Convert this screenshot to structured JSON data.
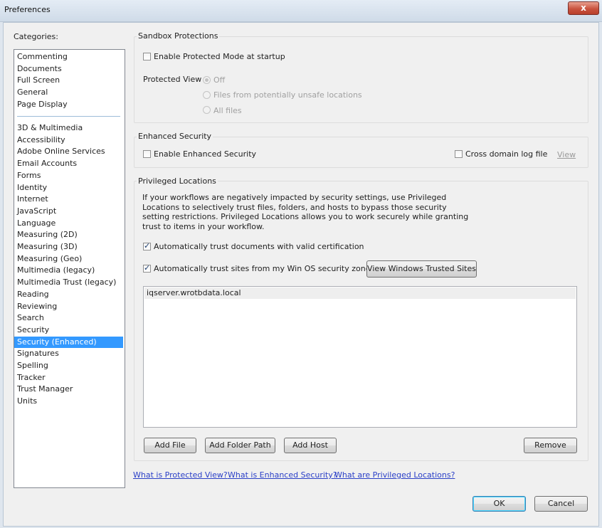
{
  "window": {
    "title": "Preferences",
    "close_glyph": "x"
  },
  "categories": {
    "label": "Categories:",
    "top_items": [
      "Commenting",
      "Documents",
      "Full Screen",
      "General",
      "Page Display"
    ],
    "items": [
      "3D & Multimedia",
      "Accessibility",
      "Adobe Online Services",
      "Email Accounts",
      "Forms",
      "Identity",
      "Internet",
      "JavaScript",
      "Language",
      "Measuring (2D)",
      "Measuring (3D)",
      "Measuring (Geo)",
      "Multimedia (legacy)",
      "Multimedia Trust (legacy)",
      "Reading",
      "Reviewing",
      "Search",
      "Security",
      "Security (Enhanced)",
      "Signatures",
      "Spelling",
      "Tracker",
      "Trust Manager",
      "Units"
    ],
    "selected": "Security (Enhanced)"
  },
  "sandbox": {
    "title": "Sandbox Protections",
    "enable_protected_mode": {
      "label": "Enable Protected Mode at startup",
      "checked": false
    },
    "protected_view_label": "Protected View",
    "options": [
      {
        "label": "Off",
        "checked": true
      },
      {
        "label": "Files from potentially unsafe locations",
        "checked": false
      },
      {
        "label": "All files",
        "checked": false
      }
    ]
  },
  "enhanced": {
    "title": "Enhanced Security",
    "enable_label": "Enable Enhanced Security",
    "enable_checked": false,
    "cross_domain_label": "Cross domain log file",
    "cross_domain_checked": false,
    "view_link": "View"
  },
  "privileged": {
    "title": "Privileged Locations",
    "description": "If your workflows are negatively impacted by security settings, use Privileged Locations to selectively trust files, folders, and hosts to bypass those security setting restrictions. Privileged Locations allows you to work securely while granting trust to items in your workflow.",
    "trust_cert_label": "Automatically trust documents with valid certification",
    "trust_cert_checked": true,
    "trust_sites_label": "Automatically trust sites from my Win OS security zones",
    "trust_sites_checked": true,
    "view_trusted_sites_button": "View Windows Trusted Sites",
    "locations": [
      "iqserver.wrotbdata.local"
    ],
    "buttons": {
      "add_file": "Add File",
      "add_folder": "Add Folder Path",
      "add_host": "Add Host",
      "remove": "Remove"
    }
  },
  "links": {
    "protected_view": "What is Protected View?",
    "enhanced_security": "What is Enhanced Security?",
    "privileged_locations": "What are Privileged Locations?"
  },
  "dialog_buttons": {
    "ok": "OK",
    "cancel": "Cancel"
  }
}
